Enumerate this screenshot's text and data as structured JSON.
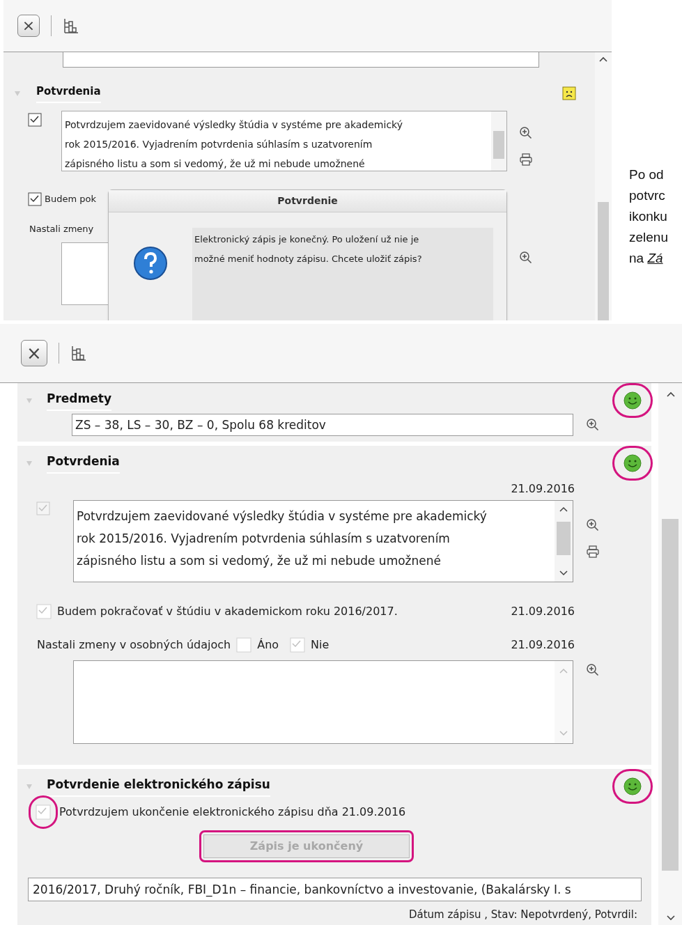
{
  "top_screenshot": {
    "toolbar": {
      "close_button": "×"
    },
    "section": {
      "title": "Potvrdenia",
      "status_ok": false
    },
    "confirm_checkbox": {
      "checked": true
    },
    "statement_lines": [
      "Potvrdzujem zaevidované výsledky štúdia v systéme pre akademický",
      "rok 2015/2016. Vyjadrením potvrdenia súhlasím s uzatvorením",
      "zápisného listu a som si vedomý, že už mi nebude umožnené"
    ],
    "continue_checkbox": {
      "label": "Budem pok",
      "checked": true
    },
    "changes_label": "Nastali zmeny",
    "dialog": {
      "title": "Potvrdenie",
      "message": "Elektronický zápis je konečný. Po uložení už nie je možné meniť  hodnoty zápisu. Chcete uložiť  zápis?"
    }
  },
  "side_note": [
    "Po od",
    "potvrc",
    "ikonku",
    "zelenu",
    "na *Zá*"
  ],
  "bottom_screenshot": {
    "toolbar": {
      "close_button": "×"
    },
    "subjects": {
      "title": "Predmety",
      "status_ok": true,
      "highlighted": true,
      "value": "ZS – 38, LS – 30, BZ – 0, Spolu 68 kreditov"
    },
    "confirmations": {
      "title": "Potvrdenia",
      "status_ok": true,
      "highlighted": true,
      "date": "21.09.2016",
      "statement_checkbox": {
        "checked": true,
        "disabled": true
      },
      "statement_lines": [
        "Potvrdzujem zaevidované výsledky štúdia v systéme pre akademický",
        "rok 2015/2016. Vyjadrením potvrdenia súhlasím s uzatvorením",
        "zápisného listu a som si vedomý, že už mi nebude umožnené"
      ],
      "continue": {
        "label": "Budem pokračovať  v štúdiu v akademickom roku 2016/2017.",
        "checked": true,
        "date": "21.09.2016"
      },
      "changes": {
        "label": "Nastali zmeny v osobných údajoch",
        "options": [
          {
            "label": "Áno",
            "checked": false
          },
          {
            "label": "Nie",
            "checked": true
          }
        ],
        "date": "21.09.2016"
      }
    },
    "electronic": {
      "title": "Potvrdenie elektronického zápisu",
      "status_ok": true,
      "highlighted": true,
      "checkbox": {
        "label": "Potvrdzujem ukončenie elektronického zápisu dňa 21.09.2016",
        "checked": true,
        "highlighted": true
      },
      "button": {
        "label": "Zápis je ukončený",
        "disabled": true,
        "highlighted": true
      }
    },
    "study_field": "2016/2017, Druhý ročník, FBI_D1n – financie, bankovníctvo a investovanie, (Bakalársky I. s",
    "footer": "Dátum zápisu , Stav: Nepotvrdený, Potvrdil:"
  }
}
